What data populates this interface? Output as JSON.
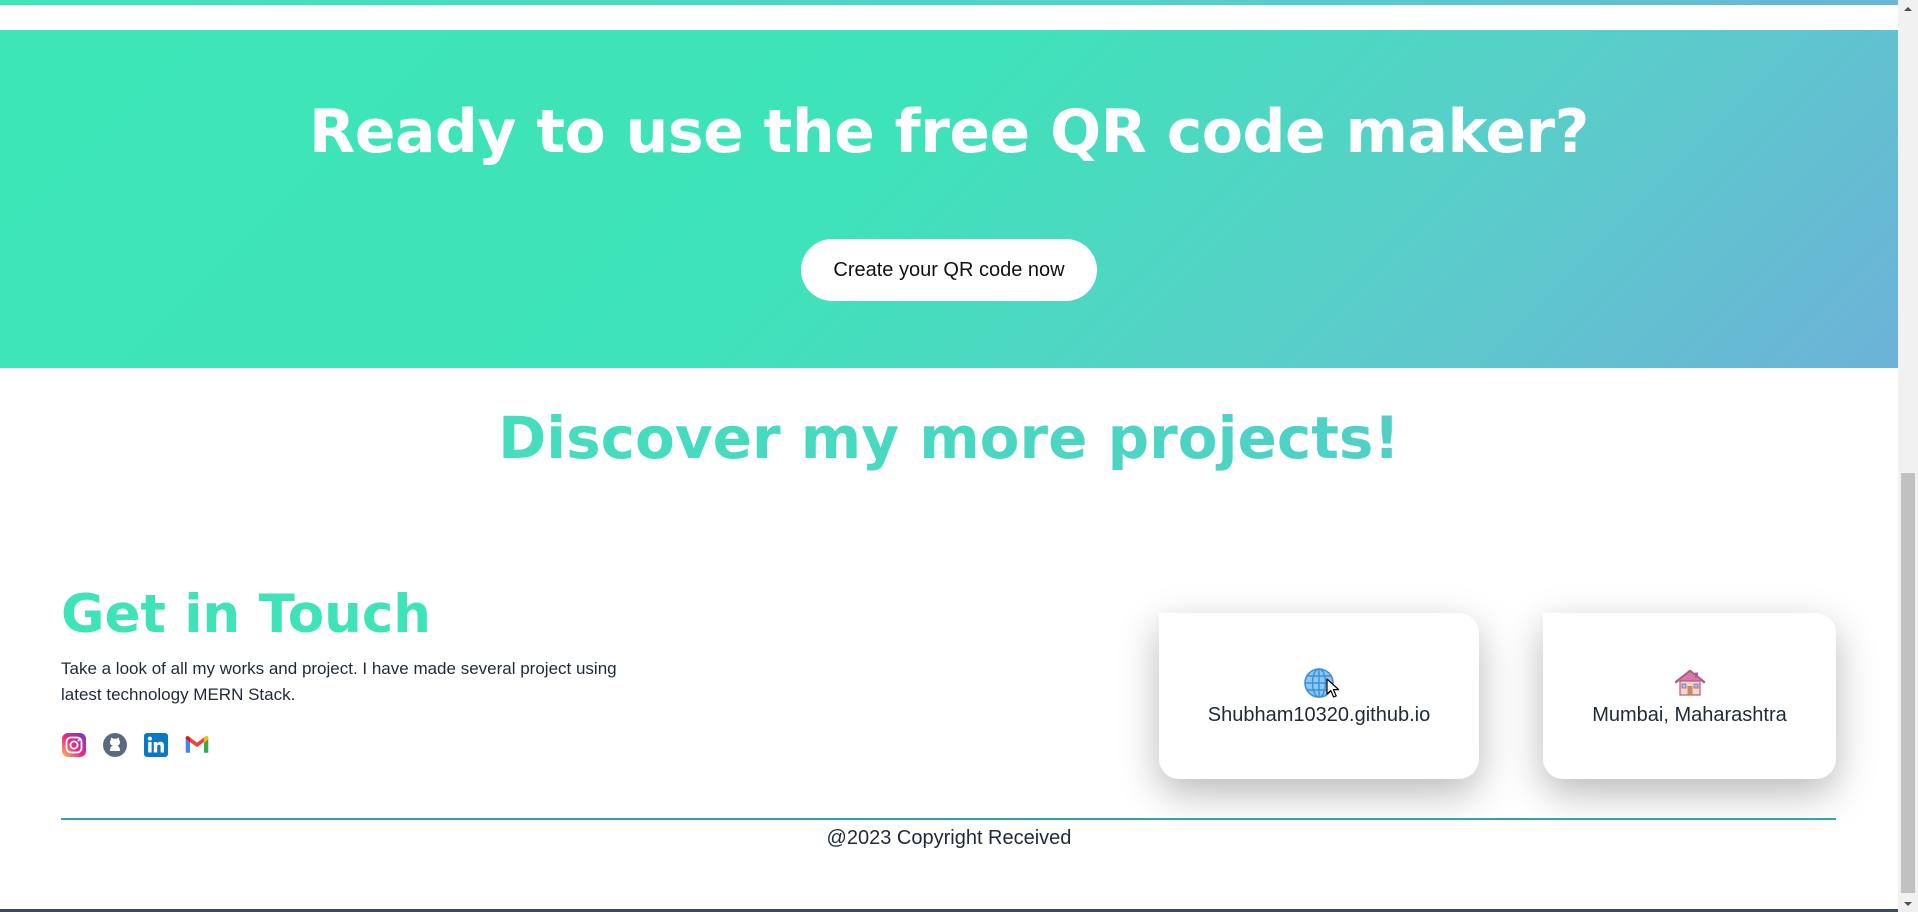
{
  "cta": {
    "title": "Ready to use the free QR code maker?",
    "button_label": "Create your QR code now"
  },
  "projects": {
    "title": "Discover my more projects!"
  },
  "contact": {
    "title": "Get in Touch",
    "description": "Take a look of all my works and project. I have made several project using latest technology MERN Stack.",
    "socials": [
      {
        "icon": "instagram-icon"
      },
      {
        "icon": "github-icon"
      },
      {
        "icon": "linkedin-icon"
      },
      {
        "icon": "gmail-icon"
      }
    ]
  },
  "cards": {
    "website": {
      "icon": "globe-icon",
      "text": "Shubham10320.github.io"
    },
    "location": {
      "icon": "house-icon",
      "text": "Mumbai, Maharashtra"
    }
  },
  "footer": {
    "copyright": "@2023 Copyright Received"
  },
  "colors": {
    "accent": "#3de6b7",
    "gradient_end": "#6db2d8",
    "divider": "#2ea7a8"
  }
}
